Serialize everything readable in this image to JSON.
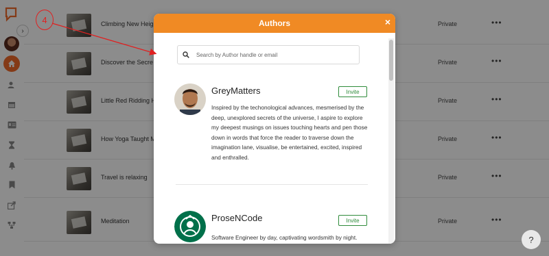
{
  "annotation": {
    "number": "4"
  },
  "rows": [
    {
      "title": "Climbing New Heig",
      "status": "Private",
      "more": "•••"
    },
    {
      "title": "Discover the Secre",
      "status": "Private",
      "more": "•••"
    },
    {
      "title": "Little Red Ridding H",
      "status": "Private",
      "more": "•••"
    },
    {
      "title": "How Yoga Taught M",
      "status": "Private",
      "more": "•••"
    },
    {
      "title": "Travel is relaxing",
      "status": "Private",
      "more": "•••"
    },
    {
      "title": "Meditation",
      "status": "Private",
      "more": "•••"
    }
  ],
  "modal": {
    "title": "Authors",
    "close": "×",
    "search_placeholder": "Search by Author handle or email",
    "invite_label": "Invite",
    "authors": [
      {
        "name": "GreyMatters",
        "bio": "Inspired by the techonological advances, mesmerised by the deep, unexplored secrets of the universe, I aspire to explore my deepest musings on issues touching hearts and pen those down in words that force the reader to traverse down the imagination lane, visualise, be entertained, excited, inspired and enthralled."
      },
      {
        "name": "ProseNCode",
        "bio": "Software Engineer by day, captivating wordsmith by night. Crafting imaginative tales and compelling"
      }
    ]
  },
  "help": {
    "label": "?"
  },
  "colors": {
    "accent": "#f08a24",
    "invite": "#2e8b3a",
    "brand": "#f06a2a"
  }
}
